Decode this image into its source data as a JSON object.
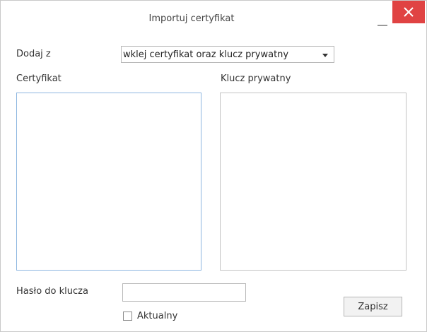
{
  "window": {
    "title": "Importuj certyfikat",
    "close_color": "#e04343",
    "minimize_icon": "minimize-icon",
    "close_icon": "close-icon"
  },
  "form": {
    "add_from_label": "Dodaj z",
    "add_from_selected": "wklej certyfikat oraz klucz prywatny",
    "certificate_label": "Certyfikat",
    "certificate_value": "",
    "private_key_label": "Klucz prywatny",
    "private_key_value": "",
    "password_label": "Hasło do klucza",
    "password_value": "",
    "current_label": "Aktualny",
    "current_checked": false
  },
  "actions": {
    "save_label": "Zapisz"
  },
  "colors": {
    "focus_border": "#8db6e0"
  }
}
